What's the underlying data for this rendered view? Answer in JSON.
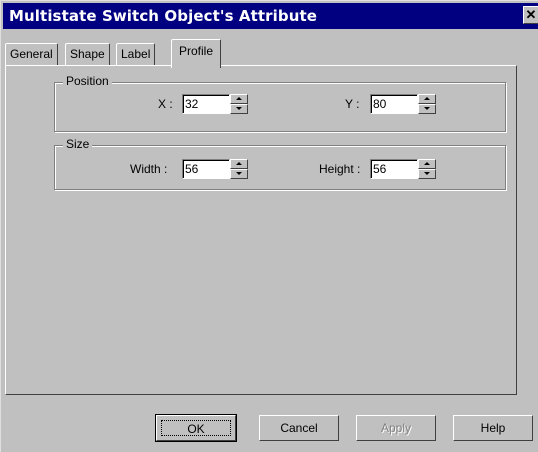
{
  "window": {
    "title": "Multistate Switch Object's Attribute",
    "close_glyph": "✕"
  },
  "tabs": [
    {
      "label": "General"
    },
    {
      "label": "Shape"
    },
    {
      "label": "Label"
    },
    {
      "label": "Profile",
      "active": true
    }
  ],
  "position": {
    "title": "Position",
    "x_label": "X :",
    "x_value": "32",
    "y_label": "Y :",
    "y_value": "80"
  },
  "size": {
    "title": "Size",
    "width_label": "Width :",
    "width_value": "56",
    "height_label": "Height :",
    "height_value": "56"
  },
  "buttons": {
    "ok": "OK",
    "cancel": "Cancel",
    "apply": "Apply",
    "help": "Help"
  },
  "icons": [
    "close-icon",
    "spin-up-icon",
    "spin-down-icon"
  ],
  "colors": {
    "titlebar": "#000080",
    "face": "#c0c0c0"
  }
}
